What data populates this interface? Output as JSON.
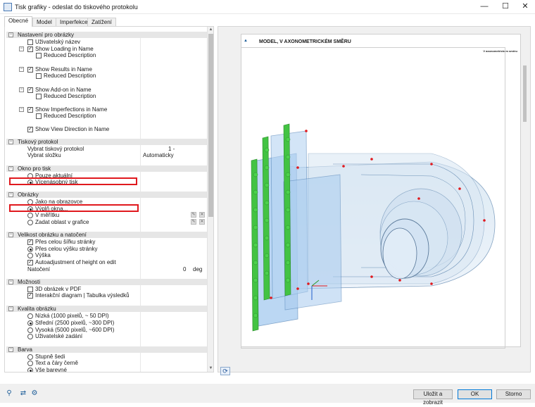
{
  "window": {
    "title": "Tisk grafiky - odeslat do tiskového protokolu"
  },
  "tabs": [
    "Obecné",
    "Model",
    "Imperfekce",
    "Zatížení"
  ],
  "sections": {
    "nastaveni": {
      "title": "Nastavení pro obrázky",
      "items": [
        "Uživatelský název",
        "Show Loading in Name",
        "Reduced Description",
        "Show Results in Name",
        "Reduced Description",
        "Show Add-on in Name",
        "Reduced Description",
        "Show Imperfections in Name",
        "Reduced Description",
        "Show View Direction in Name"
      ]
    },
    "protokol": {
      "title": "Tiskový protokol",
      "items": [
        "Vybrat tiskový protokol",
        "Vybrat složku"
      ],
      "values": [
        "1 -",
        "Automaticky"
      ]
    },
    "okno": {
      "title": "Okno pro tisk",
      "items": [
        "Pouze aktuální",
        "Vícenásobný tisk"
      ]
    },
    "obrazky": {
      "title": "Obrázky",
      "items": [
        "Jako na obrazovce",
        "Výplň okna...",
        "V měřítku",
        "Zadat oblast v grafice"
      ]
    },
    "velikost": {
      "title": "Velikost obrázku a natočení",
      "items": [
        "Přes celou šířku stránky",
        "Přes celou výšku stránky",
        "Výška",
        "Autoadjustment of height on edit",
        "Natočení"
      ],
      "rotation_value": "0",
      "rotation_unit": "deg"
    },
    "moznosti": {
      "title": "Možnosti",
      "items": [
        "3D obrázek v PDF",
        "Interakční diagram | Tabulka výsledků"
      ]
    },
    "kvalita": {
      "title": "Kvalita obrázku",
      "items": [
        "Nízká (1000 pixelů, ~ 50 DPI)",
        "Střední (2500 pixelů, ~300 DPI)",
        "Vysoká (5000 pixelů, ~600 DPI)",
        "Uživatelské zadání"
      ]
    },
    "barva": {
      "title": "Barva",
      "items": [
        "Stupně šedi",
        "Text a čáry černě",
        "Vše barevné"
      ]
    }
  },
  "preview": {
    "title": "MODEL, V AXONOMETRICKÉM SMĚRU",
    "subtitle": "V axonometrickém směru"
  },
  "buttons": {
    "save_show": "Uložit a zobrazit",
    "ok": "OK",
    "cancel": "Storno"
  },
  "colors": {
    "highlight": "#e0191e",
    "accent": "#0078d7"
  }
}
